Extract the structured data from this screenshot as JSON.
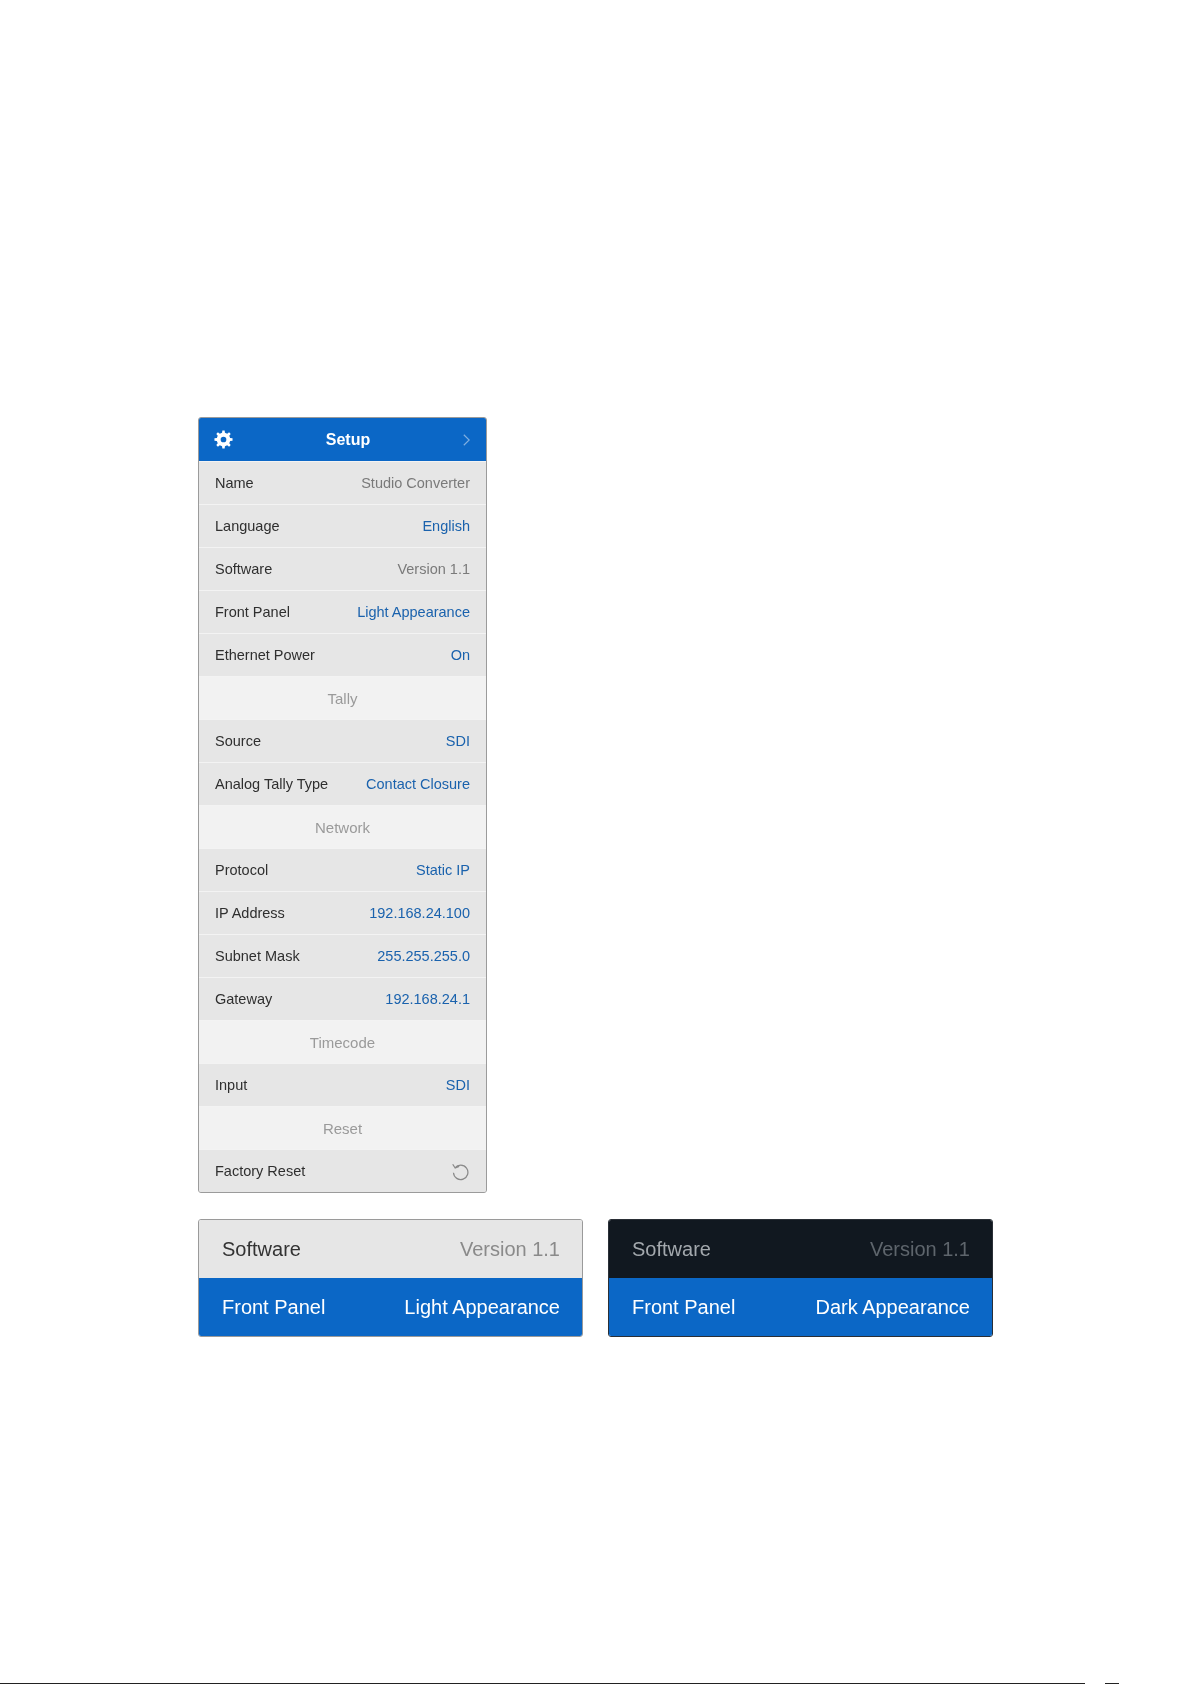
{
  "settings_panel": {
    "title": "Setup",
    "rows": [
      {
        "kind": "setting",
        "label": "Name",
        "value": "Studio Converter",
        "editable": false
      },
      {
        "kind": "setting",
        "label": "Language",
        "value": "English",
        "editable": true
      },
      {
        "kind": "setting",
        "label": "Software",
        "value": "Version 1.1",
        "editable": false
      },
      {
        "kind": "setting",
        "label": "Front Panel",
        "value": "Light Appearance",
        "editable": true
      },
      {
        "kind": "setting",
        "label": "Ethernet Power",
        "value": "On",
        "editable": true
      },
      {
        "kind": "section",
        "label": "Tally"
      },
      {
        "kind": "setting",
        "label": "Source",
        "value": "SDI",
        "editable": true
      },
      {
        "kind": "setting",
        "label": "Analog Tally Type",
        "value": "Contact Closure",
        "editable": true
      },
      {
        "kind": "section",
        "label": "Network"
      },
      {
        "kind": "setting",
        "label": "Protocol",
        "value": "Static IP",
        "editable": true
      },
      {
        "kind": "setting",
        "label": "IP Address",
        "value": "192.168.24.100",
        "editable": true
      },
      {
        "kind": "setting",
        "label": "Subnet Mask",
        "value": "255.255.255.0",
        "editable": true
      },
      {
        "kind": "setting",
        "label": "Gateway",
        "value": "192.168.24.1",
        "editable": true
      },
      {
        "kind": "section",
        "label": "Timecode"
      },
      {
        "kind": "setting",
        "label": "Input",
        "value": "SDI",
        "editable": true
      },
      {
        "kind": "section",
        "label": "Reset"
      },
      {
        "kind": "action",
        "label": "Factory Reset"
      }
    ]
  },
  "appearance_previews": [
    {
      "kind": "light",
      "rows": [
        {
          "label": "Software",
          "value": "Version 1.1",
          "selected": false
        },
        {
          "label": "Front Panel",
          "value": "Light Appearance",
          "selected": true
        }
      ]
    },
    {
      "kind": "dark",
      "rows": [
        {
          "label": "Software",
          "value": "Version 1.1",
          "selected": false
        },
        {
          "label": "Front Panel",
          "value": "Dark Appearance",
          "selected": true
        }
      ]
    }
  ]
}
